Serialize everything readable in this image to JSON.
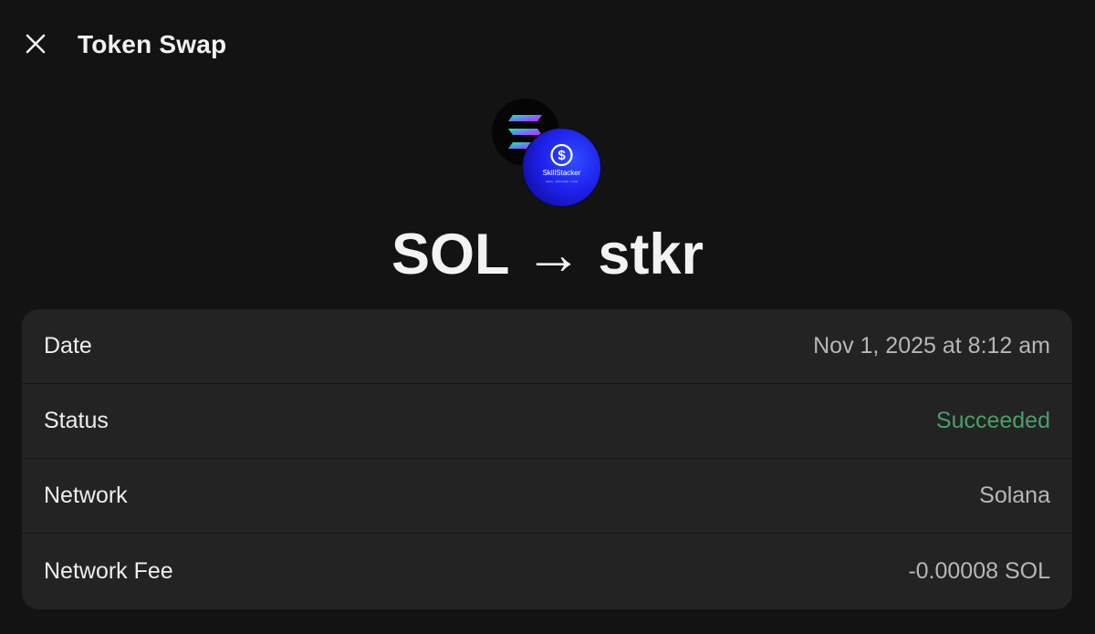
{
  "header": {
    "title": "Token Swap",
    "close_icon": "close-icon"
  },
  "swap": {
    "from_token": "SOL",
    "arrow": "→",
    "to_token": "stkr",
    "from_icon": "solana-logo-icon",
    "to_icon": "skillstacker-dollar-icon",
    "to_icon_text": "SkillStacker",
    "to_icon_caption": "SKILL · STACKER · COIN"
  },
  "details": [
    {
      "label": "Date",
      "value": "Nov 1, 2025 at 8:12 am"
    },
    {
      "label": "Status",
      "value": "Succeeded"
    },
    {
      "label": "Network",
      "value": "Solana"
    },
    {
      "label": "Network Fee",
      "value": "-0.00008 SOL"
    }
  ],
  "colors": {
    "background": "#131313",
    "card": "#232323",
    "success": "#49a06a",
    "muted_value": "#b7b7b7"
  }
}
